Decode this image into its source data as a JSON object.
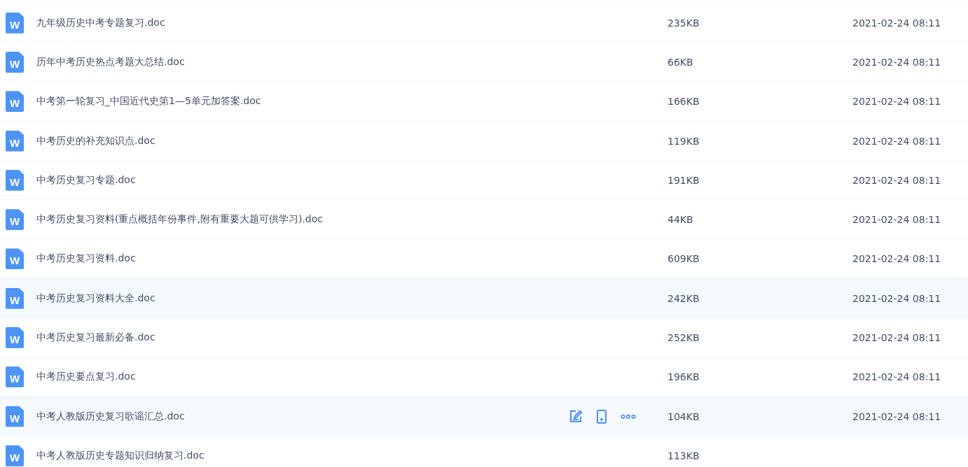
{
  "files": [
    {
      "icon_label": "W",
      "name": "九年级历史中考专题复习.doc",
      "size": "235KB",
      "modified": "2021-02-24 08:11",
      "highlighted": false,
      "show_actions": false
    },
    {
      "icon_label": "W",
      "name": "历年中考历史热点考题大总结.doc",
      "size": "66KB",
      "modified": "2021-02-24 08:11",
      "highlighted": false,
      "show_actions": false
    },
    {
      "icon_label": "W",
      "name": "中考第一轮复习_中国近代史第1—5单元加答案.doc",
      "size": "166KB",
      "modified": "2021-02-24 08:11",
      "highlighted": false,
      "show_actions": false
    },
    {
      "icon_label": "W",
      "name": "中考历史的补充知识点.doc",
      "size": "119KB",
      "modified": "2021-02-24 08:11",
      "highlighted": false,
      "show_actions": false
    },
    {
      "icon_label": "W",
      "name": "中考历史复习专题.doc",
      "size": "191KB",
      "modified": "2021-02-24 08:11",
      "highlighted": false,
      "show_actions": false
    },
    {
      "icon_label": "W",
      "name": "中考历史复习资料(重点概括年份事件,附有重要大题可供学习).doc",
      "size": "44KB",
      "modified": "2021-02-24 08:11",
      "highlighted": false,
      "show_actions": false
    },
    {
      "icon_label": "W",
      "name": "中考历史复习资料.doc",
      "size": "609KB",
      "modified": "2021-02-24 08:11",
      "highlighted": false,
      "show_actions": false
    },
    {
      "icon_label": "W",
      "name": "中考历史复习资料大全.doc",
      "size": "242KB",
      "modified": "2021-02-24 08:11",
      "highlighted": true,
      "show_actions": false
    },
    {
      "icon_label": "W",
      "name": "中考历史复习最新必备.doc",
      "size": "252KB",
      "modified": "2021-02-24 08:11",
      "highlighted": false,
      "show_actions": false
    },
    {
      "icon_label": "W",
      "name": "中考历史要点复习.doc",
      "size": "196KB",
      "modified": "2021-02-24 08:11",
      "highlighted": false,
      "show_actions": false
    },
    {
      "icon_label": "W",
      "name": "中考人教版历史复习歌谣汇总.doc",
      "size": "104KB",
      "modified": "2021-02-24 08:11",
      "highlighted": true,
      "show_actions": true
    },
    {
      "icon_label": "W",
      "name": "中考人教版历史专题知识归纳复习.doc",
      "size": "113KB",
      "highlighted": false,
      "show_actions": false
    }
  ]
}
